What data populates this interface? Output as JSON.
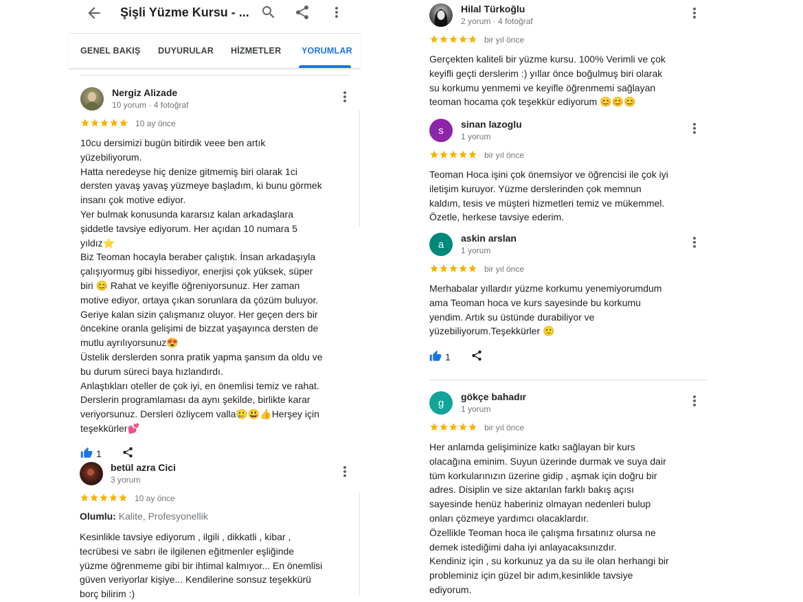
{
  "appbar": {
    "title": "Şişli Yüzme Kursu - ..."
  },
  "tabs": [
    {
      "label": "GENEL BAKIŞ"
    },
    {
      "label": "DUYURULAR"
    },
    {
      "label": "HİZMETLER"
    },
    {
      "label": "YORUMLAR"
    }
  ],
  "active_tab": "YORUMLAR",
  "colors": {
    "accent": "#1a73e8",
    "star": "#f4b400",
    "avatar_s": "#8e24aa",
    "avatar_a": "#00897b",
    "avatar_g": "#12a39a"
  },
  "left_reviews": [
    {
      "name": "Nergiz Alizade",
      "meta": "10 yorum · 4 fotoğraf",
      "rating": 5,
      "time": "10 ay önce",
      "lines": [
        "10cu dersimizi bugün bitirdik veee ben artık",
        "yüzebiliyorum.",
        "Hatta neredeyse hiç denize gitmemiş biri olarak  1ci",
        "dersten yavaş yavaş yüzmeye başladım, ki bunu görmek",
        "insanı çok motive ediyor.",
        "Yer bulmak konusunda kararsız kalan arkadaşlara",
        "şiddetle tavsiye ediyorum. Her açıdan 10 numara 5",
        "yıldız⭐",
        "Biz Teoman hocayla beraber çalıştık. İnsan arkadaşıyla",
        "çalışıyormuş gibi hissediyor, enerjisi çok yüksek, süper",
        "biri 😊 Rahat ve keyifle öğreniyorsunuz. Her zaman",
        "motive ediyor, ortaya çıkan sorunlara da çözüm buluyor.",
        "Geriye kalan sizin çalışmanız oluyor. Her geçen ders bir",
        "öncekine oranla gelişimi de bizzat yaşayınca dersten de",
        "mutlu ayrılıyorsunuz😍",
        "Üstelik derslerden sonra pratik yapma şansım da oldu ve",
        "bu durum süreci baya hızlandırdı.",
        "Anlaştıkları oteller de çok iyi, en önemlisi temiz ve rahat.",
        "Derslerin programlaması da aynı şekilde, birlikte karar",
        "veriyorsunuz. Dersleri özliycem valla🥲😃👍Herşey için",
        "teşekkürler💕"
      ],
      "likes": "1"
    },
    {
      "name": "betül azra Cici",
      "meta": "3 yorum",
      "rating": 5,
      "time": "10 ay önce",
      "highlight_label": "Olumlu:",
      "highlight_value": " Kalite, Profesyonellik",
      "lines": [
        "Kesinlikle tavsiye ediyorum , ilgili , dikkatli , kibar ,",
        "tecrübesi ve sabrı ile ilgilenen eğitmenler eşliğinde",
        "yüzme öğrenmeme gibi bir ihtimal kalmıyor... En önemlisi",
        "güven veriyorlar kişiye... Kendilerine sonsuz teşekkürü",
        "borç bilirim :)"
      ]
    }
  ],
  "right_reviews": [
    {
      "name": "Hilal Türkoğlu",
      "meta": "2 yorum · 4 fotoğraf",
      "rating": 5,
      "time": "bir yıl önce",
      "lines": [
        "Gerçekten kaliteli bir yüzme kursu. 100% Verimli ve çok",
        "keyifli geçti derslerim :) yıllar önce boğulmuş biri olarak",
        "su korkumu yenmemi ve keyifle öğrenmemi sağlayan",
        "teoman hocama çok teşekkür ediyorum 😊😊😊"
      ]
    },
    {
      "name": "sinan lazoglu",
      "initial": "s",
      "meta": "1 yorum",
      "rating": 5,
      "time": "bir yıl önce",
      "lines": [
        "Teoman Hoca işini çok önemsiyor ve öğrencisi ile çok iyi",
        "iletişim kuruyor.  Yüzme derslerinden çok memnun",
        "kaldım, tesis ve müşteri hizmetleri temiz ve mükemmel.",
        "Özetle, herkese tavsiye ederim."
      ]
    },
    {
      "name": "askin arslan",
      "initial": "a",
      "meta": "1 yorum",
      "rating": 5,
      "time": "bir yıl önce",
      "lines": [
        "Merhabalar yıllardır yüzme korkumu yenemiyorumdum",
        "ama Teoman hoca ve kurs  sayesinde bu korkumu",
        "yendim. Artık su üstünde durabiliyor ve",
        "yüzebiliyorum.Teşekkürler 🙂"
      ],
      "likes": "1"
    },
    {
      "name": "gökçe bahadır",
      "initial": "g",
      "meta": "1 yorum",
      "rating": 5,
      "time": "bir yıl önce",
      "lines": [
        "Her anlamda gelişiminize katkı sağlayan bir kurs",
        "olacağına eminim. Suyun üzerinde durmak ve suya dair",
        "tüm korkularınızın üzerine gidip , aşmak için doğru bir",
        "adres. Disiplin ve size aktarılan farklı bakış açısı",
        "sayesinde henüz haberiniz olmayan nedenleri bulup",
        "onları çözmeye yardımcı olacaklardır.",
        "Özellikle Teoman hoca ile çalışma fırsatınız olursa ne",
        "demek istediğimi daha iyi anlayacaksınızdır.",
        "Kendiniz için , su korkunuz ya da su ile olan herhangi bir",
        "probleminiz için  güzel bir adım,kesinlikle tavsiye",
        "ediyorum."
      ]
    }
  ]
}
